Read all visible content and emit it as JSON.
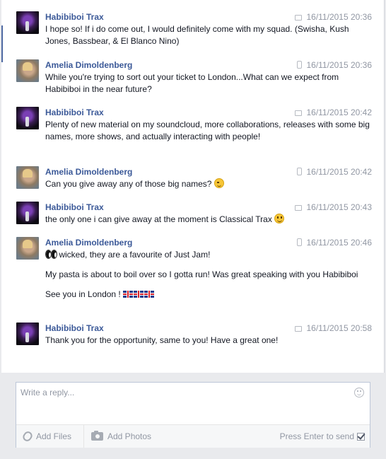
{
  "thread": {
    "messages": [
      {
        "author": "Habibiboi Trax",
        "avatar": "habibiboi-avatar",
        "device": "desktop-icon",
        "timestamp": "16/11/2015 20:36",
        "lines": [
          "I hope so! If i do come out, I would definitely come with my squad. (Swisha, Kush Jones, Bassbear, & El Blanco Nino)"
        ]
      },
      {
        "author": "Amelia Dimoldenberg",
        "avatar": "amelia-avatar",
        "device": "phone-icon",
        "timestamp": "16/11/2015 20:36",
        "lines": [
          "While you're trying to sort out your ticket to London...What can we expect from Habibiboi in the near future?"
        ]
      },
      {
        "author": "Habibiboi Trax",
        "avatar": "habibiboi-avatar",
        "device": "desktop-icon",
        "timestamp": "16/11/2015 20:42",
        "lines": [
          "Plenty of new material on my soundcloud, more collaborations, releases with some big names, more shows, and actually interacting with people!"
        ]
      },
      {
        "author": "Amelia Dimoldenberg",
        "avatar": "amelia-avatar",
        "device": "phone-icon",
        "timestamp": "16/11/2015 20:42",
        "lines": [
          "Can you give away any of those big names?"
        ],
        "emoji": "wink-emoji"
      },
      {
        "author": "Habibiboi Trax",
        "avatar": "habibiboi-avatar",
        "device": "desktop-icon",
        "timestamp": "16/11/2015 20:43",
        "lines": [
          "the only one i can give away at the moment is Classical Trax"
        ],
        "emoji": "smile-emoji"
      },
      {
        "author": "Amelia Dimoldenberg",
        "avatar": "amelia-avatar",
        "device": "phone-icon",
        "timestamp": "16/11/2015 20:46",
        "lines": [
          "wicked, they are a favourite of Just Jam!",
          "My pasta is about to boil over so I gotta run! Was great speaking with you Habibiboi",
          "See you in London !"
        ],
        "emoji_lead": "eyes-emoji",
        "flags": "uk-flag-icons"
      },
      {
        "author": "Habibiboi Trax",
        "avatar": "habibiboi-avatar",
        "device": "desktop-icon",
        "timestamp": "16/11/2015 20:58",
        "lines": [
          "Thank you for the opportunity, same to you! Have a great one!"
        ]
      }
    ]
  },
  "composer": {
    "placeholder": "Write a reply...",
    "add_files": "Add Files",
    "add_photos": "Add Photos",
    "press_enter": "Press Enter to send"
  },
  "colors": {
    "author": "#3b5998",
    "meta": "#9197a3",
    "accent": "#4e69a2"
  }
}
